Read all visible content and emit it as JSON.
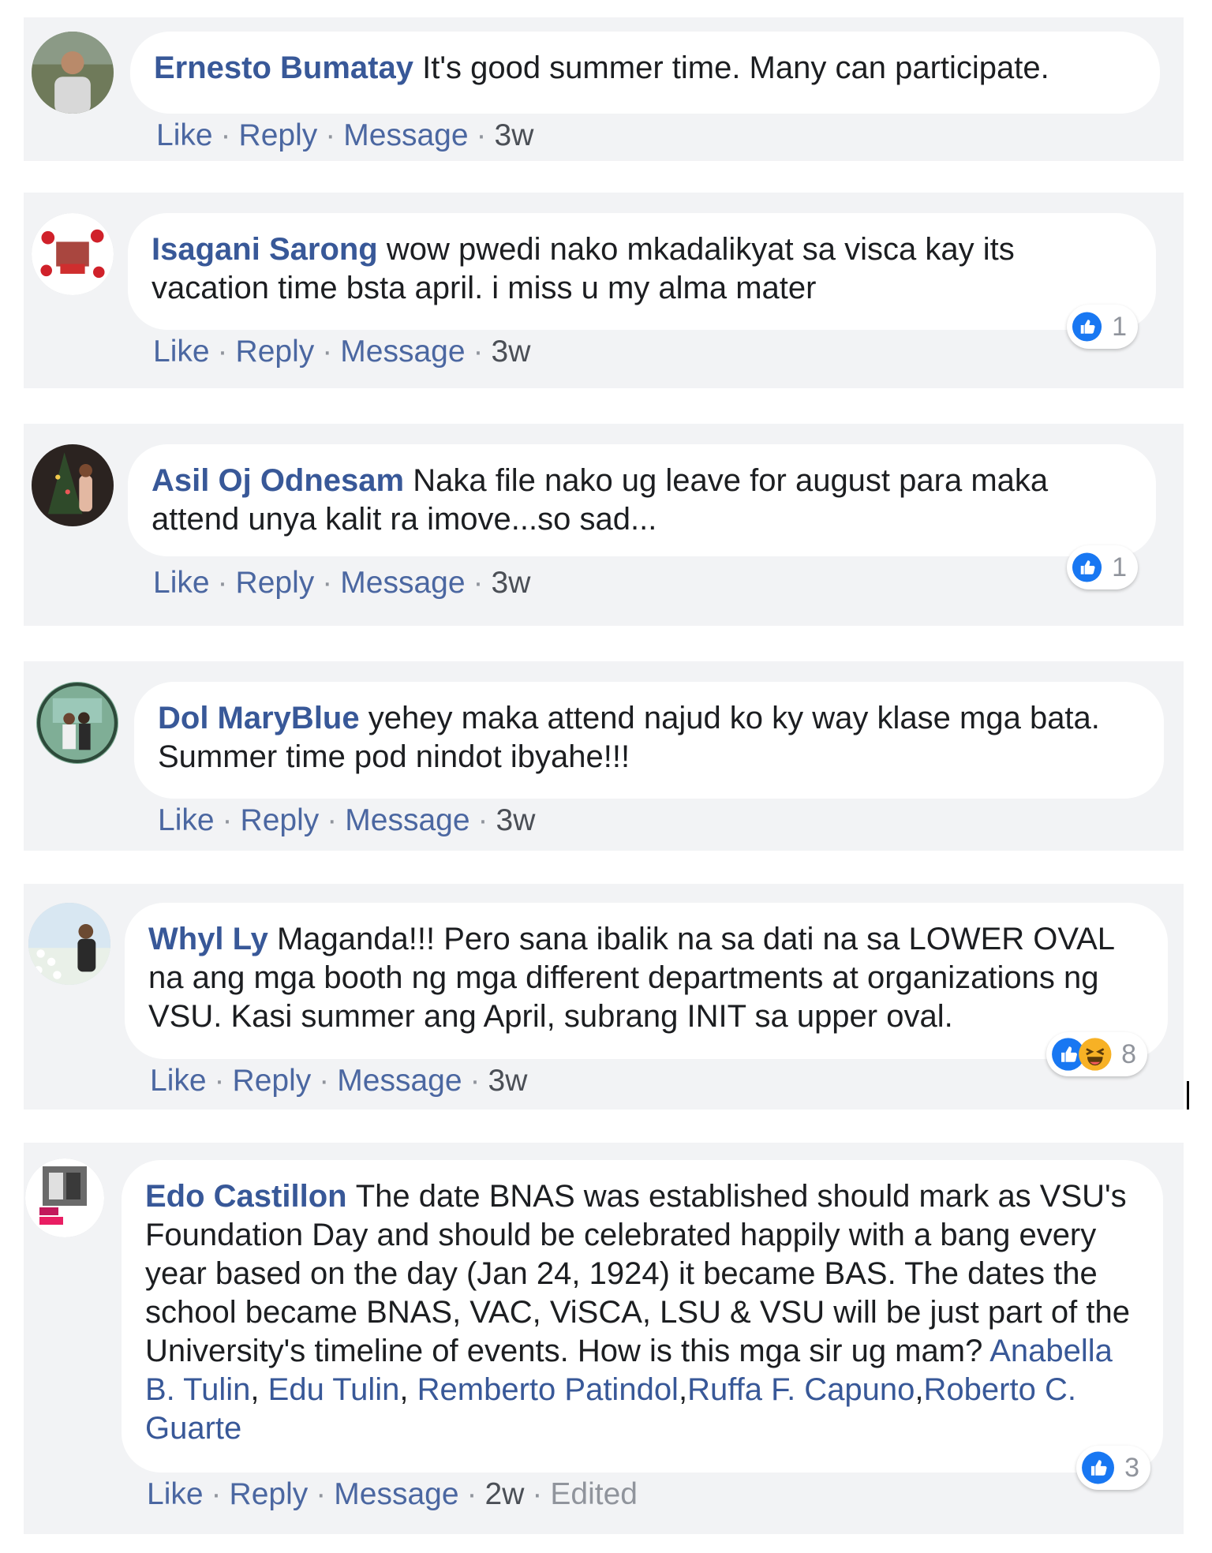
{
  "comments": [
    {
      "author": "Ernesto Bumatay",
      "text": "It's good summer time. Many can participate.",
      "actions": {
        "like": "Like",
        "reply": "Reply",
        "message": "Message",
        "time": "3w"
      },
      "avatar": "avatar-photo-man"
    },
    {
      "author": "Isagani Sarong",
      "text": "wow pwedi nako mkadalikyat sa visca kay its vacation time bsta april. i miss u my alma mater",
      "actions": {
        "like": "Like",
        "reply": "Reply",
        "message": "Message",
        "time": "3w"
      },
      "reactions": {
        "icons": [
          "like-reaction-icon"
        ],
        "count": "1"
      },
      "avatar": "avatar-photo-love-hearts"
    },
    {
      "author": "Asil Oj Odnesam",
      "text": "Naka file nako ug leave for august para maka attend unya kalit ra imove...so sad...",
      "actions": {
        "like": "Like",
        "reply": "Reply",
        "message": "Message",
        "time": "3w"
      },
      "reactions": {
        "icons": [
          "like-reaction-icon"
        ],
        "count": "1"
      },
      "avatar": "avatar-photo-christmas-tree"
    },
    {
      "author": "Dol MaryBlue",
      "text": "yehey maka attend najud ko ky way klase mga bata. Summer time pod nindot ibyahe!!!",
      "actions": {
        "like": "Like",
        "reply": "Reply",
        "message": "Message",
        "time": "3w"
      },
      "avatar": "avatar-photo-couple"
    },
    {
      "author": "Whyl Ly",
      "text": "Maganda!!! Pero sana ibalik na sa dati na sa LOWER OVAL na ang mga booth ng mga different departments at organizations ng VSU. Kasi summer ang April, subrang INIT sa upper oval.",
      "actions": {
        "like": "Like",
        "reply": "Reply",
        "message": "Message",
        "time": "3w"
      },
      "reactions": {
        "icons": [
          "like-reaction-icon",
          "haha-reaction-icon"
        ],
        "count": "8"
      },
      "avatar": "avatar-photo-flowers"
    },
    {
      "author": "Edo Castillon",
      "text": "The date BNAS was established should mark as VSU's Foundation Day and should be celebrated happily with a bang every year based on the day (Jan 24, 1924) it became BAS. The dates the school became BNAS, VAC, ViSCA, LSU & VSU will be just part of the University's timeline of events. How is this mga sir ug mam?",
      "mentions": [
        {
          "name": "Anabella B. Tulin",
          "sep": ", "
        },
        {
          "name": "Edu Tulin",
          "sep": ", "
        },
        {
          "name": "Remberto Patindol",
          "sep": ","
        },
        {
          "name": "Ruffa F. Capuno",
          "sep": ","
        },
        {
          "name": "Roberto C. Guarte",
          "sep": ""
        }
      ],
      "actions": {
        "like": "Like",
        "reply": "Reply",
        "message": "Message",
        "time": "2w",
        "edited": "Edited"
      },
      "reactions": {
        "icons": [
          "like-reaction-icon"
        ],
        "count": "3"
      },
      "avatar": "avatar-photo-love-collage"
    }
  ],
  "colors": {
    "author": "#385898",
    "action_link": "#4b67a1",
    "card_background": "#f2f3f5",
    "like_blue": "#1877f2",
    "haha_yellow": "#f7b125"
  }
}
